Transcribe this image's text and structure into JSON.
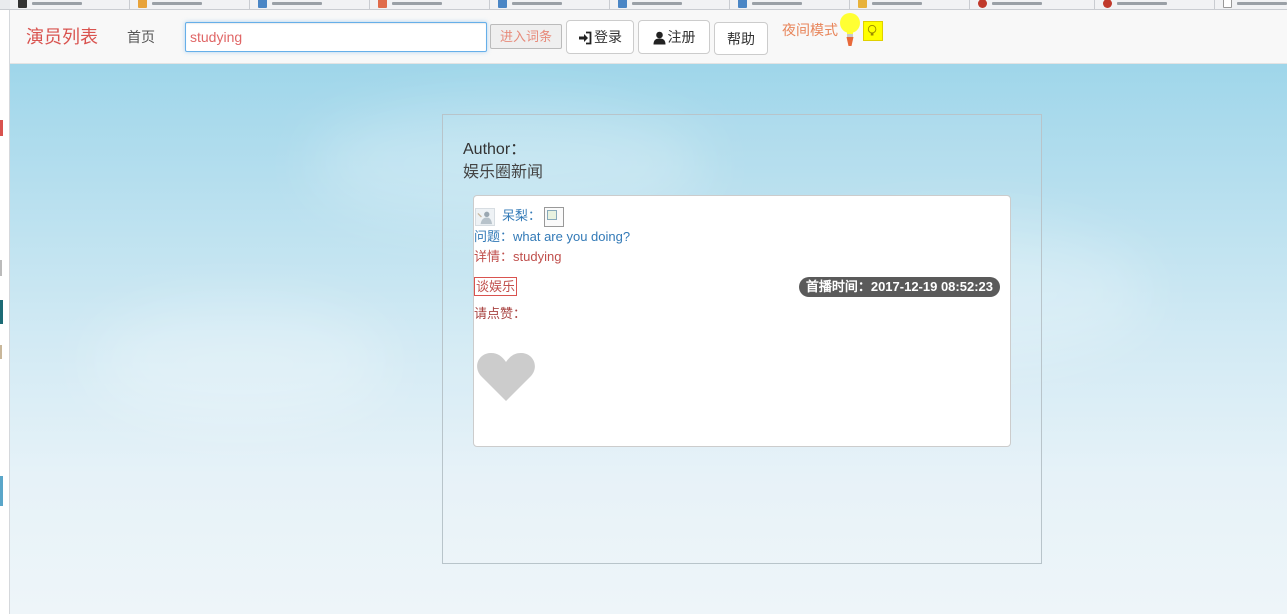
{
  "navbar": {
    "brand": "演员列表",
    "home": "首页",
    "search_value": "studying",
    "enter_button": "进入词条",
    "login_button": "登录",
    "register_button": "注册",
    "help_button": "帮助",
    "night_mode": "夜间模式"
  },
  "panel": {
    "author_label": "Author：",
    "author_name": "娱乐圈新闻"
  },
  "card": {
    "poster": "呆梨：",
    "question": "问题：what are you doing?",
    "detail": "详情：studying",
    "tag": "谈娱乐",
    "premiere_time": "首播时间：2017-12-19 08:52:23",
    "like_label": "请点赞："
  },
  "colors": {
    "brand": "#d9534f",
    "link": "#337ab7",
    "detail": "#c0504d",
    "heart": "#cccccc",
    "badge": "#5a5a5a",
    "bulb": "#ffff00"
  },
  "icons": {
    "login": "login-arrow-icon",
    "register": "user-icon",
    "night": "lightbulb-icon",
    "like": "heart-icon"
  }
}
